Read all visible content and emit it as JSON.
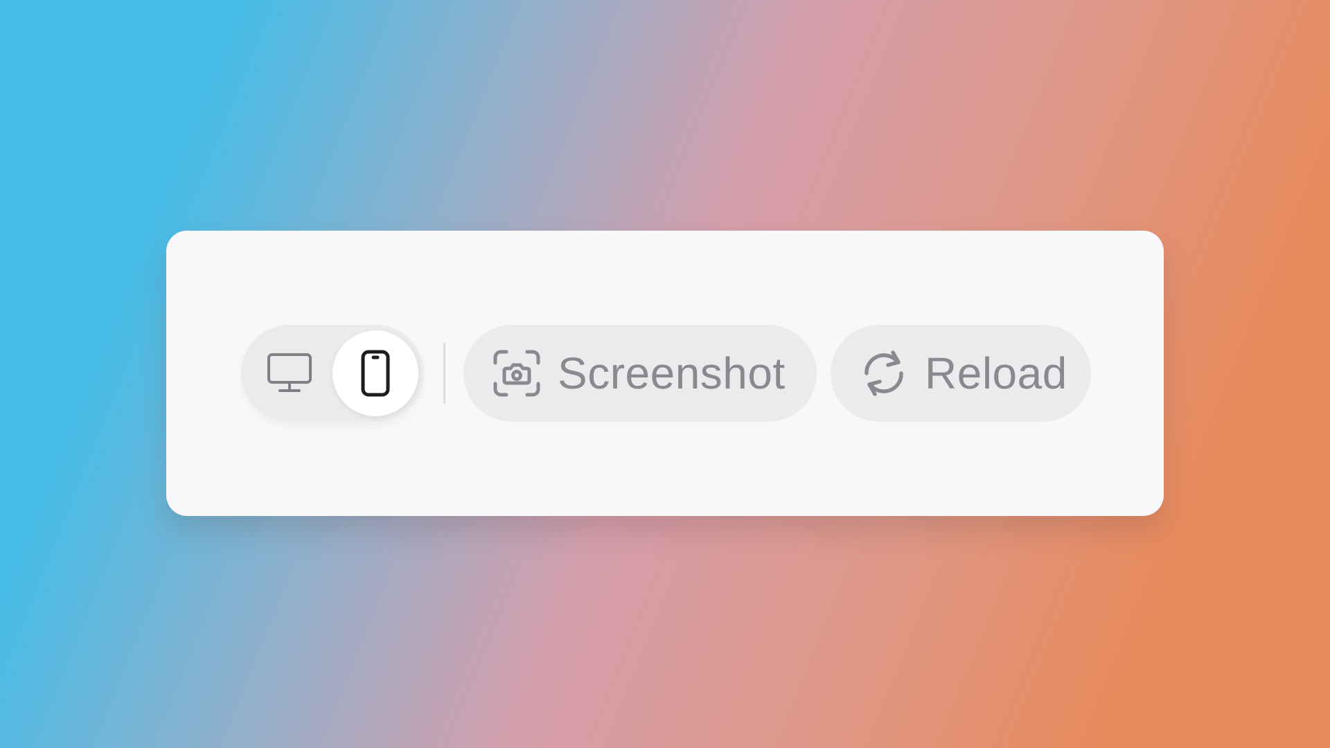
{
  "colors": {
    "card_bg": "#f8f8fa",
    "pill_bg": "#ebebed",
    "active_bg": "#ffffff",
    "text_muted": "#8a8a8e",
    "icon_active": "#1d1d1f"
  },
  "view_toggle": {
    "options": [
      {
        "id": "desktop",
        "icon": "monitor-icon",
        "selected": false
      },
      {
        "id": "mobile",
        "icon": "phone-icon",
        "selected": true
      }
    ]
  },
  "actions": {
    "screenshot": {
      "label": "Screenshot",
      "icon": "camera-icon"
    },
    "reload": {
      "label": "Reload",
      "icon": "reload-icon"
    }
  }
}
